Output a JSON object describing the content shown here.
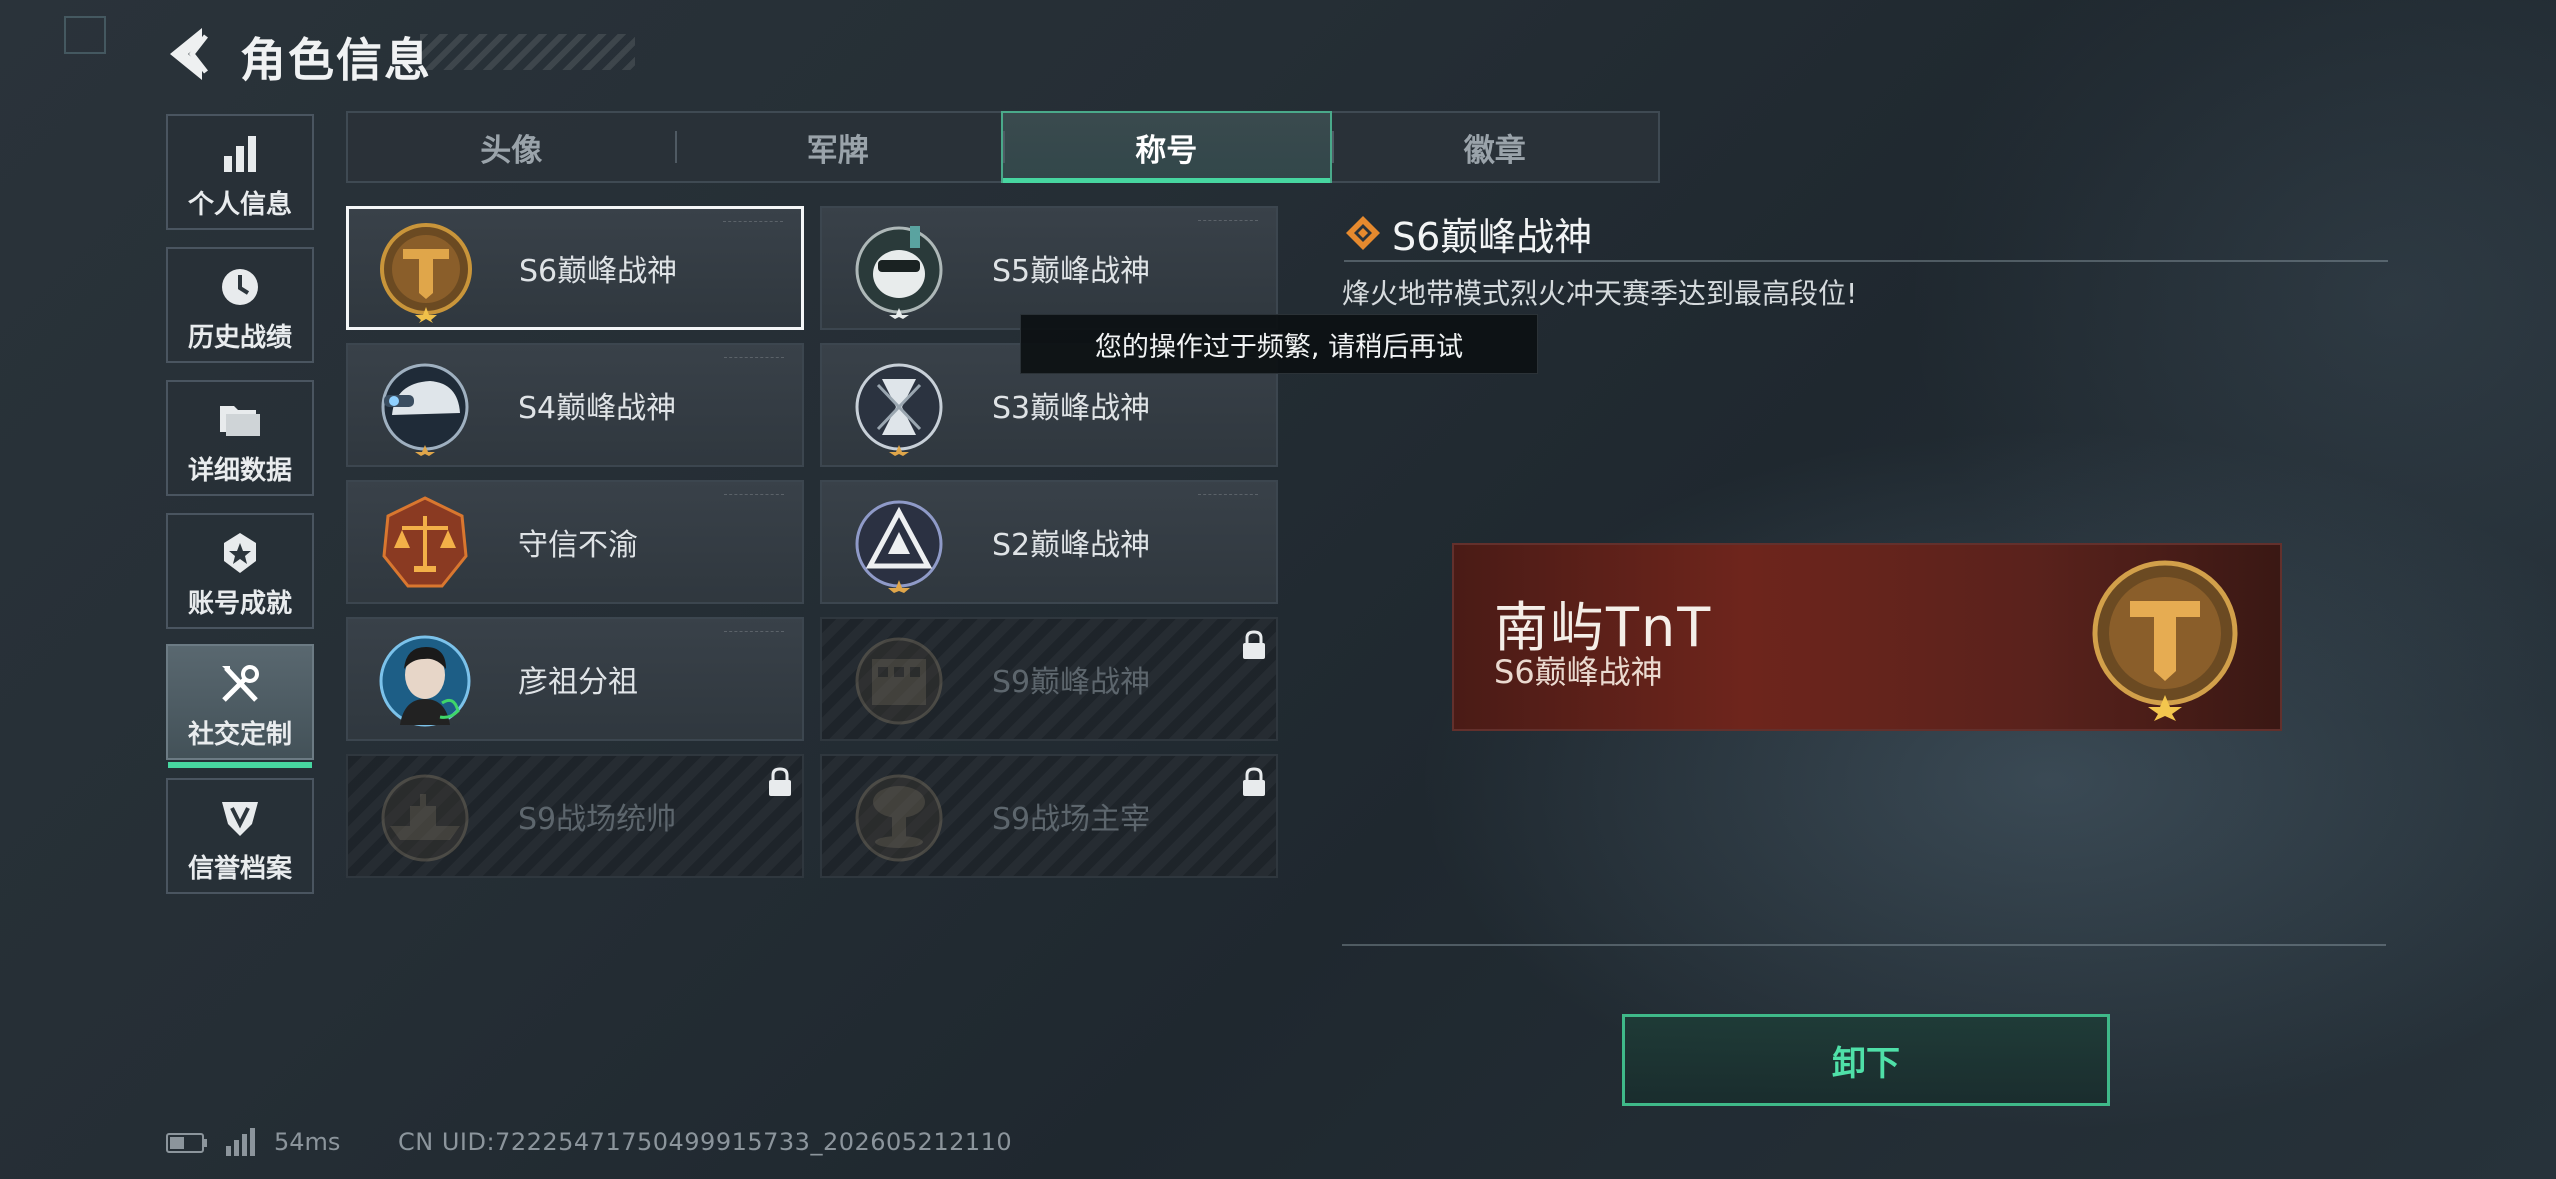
{
  "header": {
    "title": "角色信息"
  },
  "sidenav": [
    {
      "label": "个人信息",
      "icon": "bar-chart-icon"
    },
    {
      "label": "历史战绩",
      "icon": "clock-history-icon"
    },
    {
      "label": "详细数据",
      "icon": "folder-icon"
    },
    {
      "label": "账号成就",
      "icon": "achievement-icon"
    },
    {
      "label": "社交定制",
      "icon": "tools-icon",
      "active": true
    },
    {
      "label": "信誉档案",
      "icon": "credit-shield-icon"
    }
  ],
  "tabs": [
    {
      "label": "头像"
    },
    {
      "label": "军牌"
    },
    {
      "label": "称号",
      "active": true
    },
    {
      "label": "徽章"
    }
  ],
  "titles": [
    {
      "label": "S6巅峰战神",
      "badge": "golden-t-emblem-icon",
      "selected": true,
      "locked": false
    },
    {
      "label": "S5巅峰战神",
      "badge": "skull-helmet-emblem-icon",
      "selected": false,
      "locked": false
    },
    {
      "label": "S4巅峰战神",
      "badge": "helmet-emblem-icon",
      "selected": false,
      "locked": false
    },
    {
      "label": "S3巅峰战神",
      "badge": "hourglass-emblem-icon",
      "selected": false,
      "locked": false
    },
    {
      "label": "守信不渝",
      "badge": "scales-emblem-icon",
      "selected": false,
      "locked": false
    },
    {
      "label": "S2巅峰战神",
      "badge": "triangle-emblem-icon",
      "selected": false,
      "locked": false
    },
    {
      "label": "彦祖分祖",
      "badge": "portrait-emblem-icon",
      "selected": false,
      "locked": false
    },
    {
      "label": "S9巅峰战神",
      "badge": "building-emblem-icon",
      "selected": false,
      "locked": true
    },
    {
      "label": "S9战场统帅",
      "badge": "warship-emblem-icon",
      "selected": false,
      "locked": true
    },
    {
      "label": "S9战场主宰",
      "badge": "mushroom-cloud-emblem-icon",
      "selected": false,
      "locked": true
    }
  ],
  "toast": {
    "text": "您的操作过于频繁, 请稍后再试"
  },
  "detail": {
    "title": "S6巅峰战神",
    "description": "烽火地带模式烈火冲天赛季达到最高段位!",
    "nameplate": {
      "player_name": "南屿TnT",
      "title": "S6巅峰战神"
    },
    "unequip_label": "卸下"
  },
  "status": {
    "ping": "54ms",
    "uid": "CN UID:722254717504999157​33_202605212110"
  },
  "colors": {
    "accent": "#47d6a0",
    "plate_red": "#6e251c",
    "gold": "#c9953a"
  }
}
